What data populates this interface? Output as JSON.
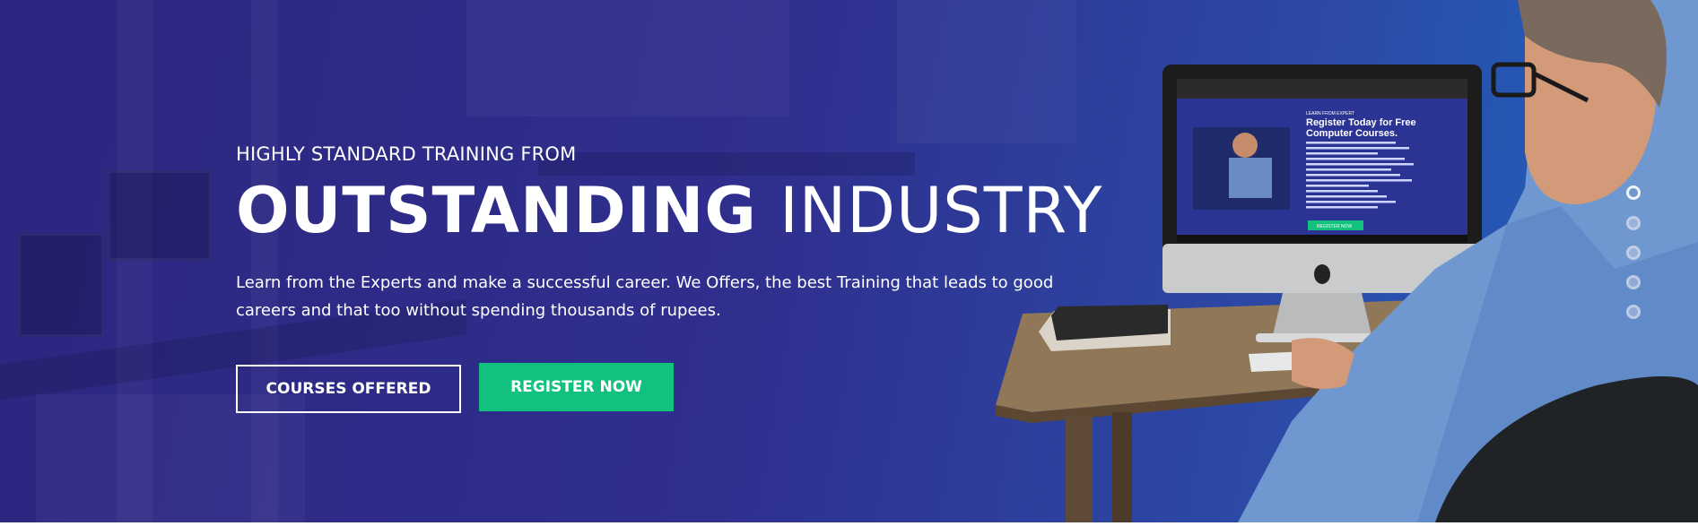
{
  "hero": {
    "eyebrow": "HIGHLY STANDARD TRAINING FROM",
    "headline_bold": "OUTSTANDING",
    "headline_light": "INDUSTRY",
    "description": "Learn from the Experts and make a successful career. We Offers, the best Training that leads to good careers and that too without spending thousands of rupees.",
    "buttons": {
      "courses_label": "COURSES OFFERED",
      "register_label": "REGISTER NOW"
    }
  },
  "slider": {
    "count": 5,
    "active_index": 0
  },
  "monitor_screen": {
    "eyebrow": "LEARN FROM EXPERT",
    "title_line1": "Register Today for Free",
    "title_line2": "Computer Courses.",
    "button": "REGISTER NOW"
  },
  "colors": {
    "hero_start": "#2c2780",
    "hero_end": "#1e66c4",
    "register_button": "#13c17e",
    "text": "#ffffff"
  }
}
